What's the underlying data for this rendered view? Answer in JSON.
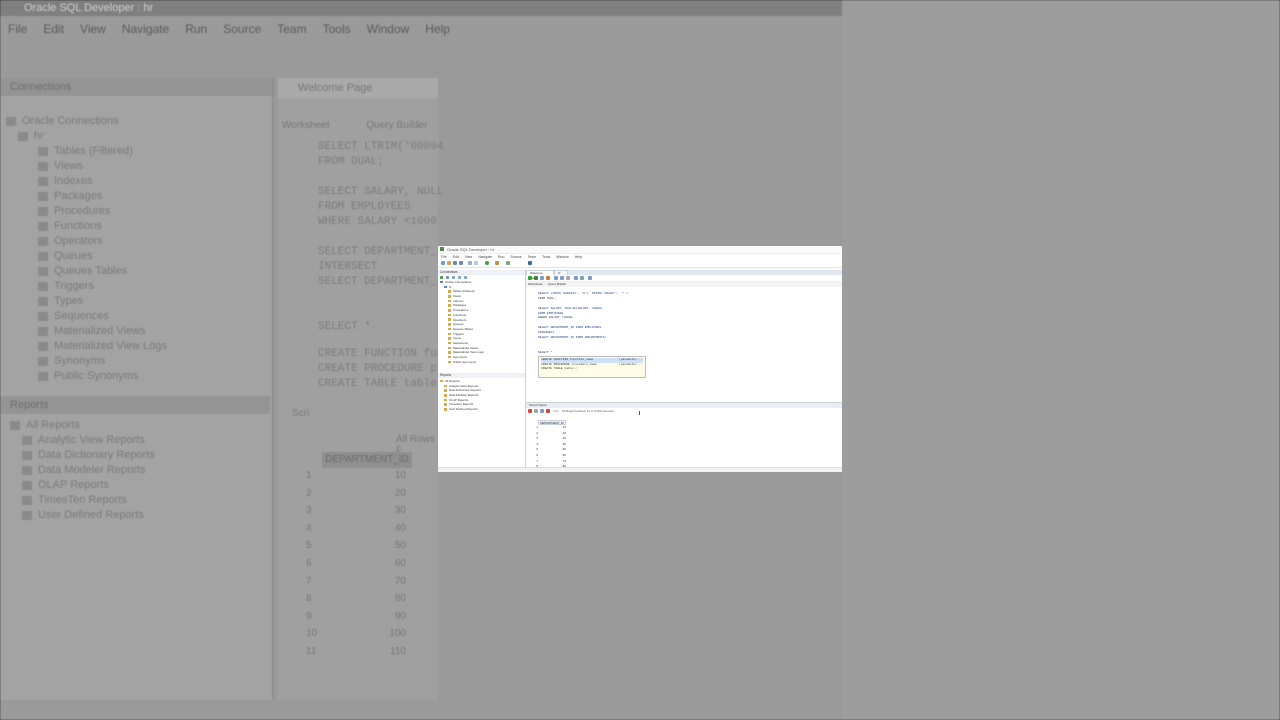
{
  "window_title": "Oracle SQL Developer : hr",
  "menus": [
    "File",
    "Edit",
    "View",
    "Navigate",
    "Run",
    "Source",
    "Team",
    "Tools",
    "Window",
    "Help"
  ],
  "connections_panel": {
    "title": "Connections",
    "root": "Oracle Connections",
    "connection": "hr",
    "items": [
      "Tables (Filtered)",
      "Views",
      "Indexes",
      "Packages",
      "Procedures",
      "Functions",
      "Operators",
      "Queues",
      "Queues Tables",
      "Triggers",
      "Types",
      "Sequences",
      "Materialized Views",
      "Materialized View Logs",
      "Synonyms",
      "Public Synonyms"
    ]
  },
  "reports_panel": {
    "title": "Reports",
    "items": [
      "All Reports",
      "Analytic View Reports",
      "Data Dictionary Reports",
      "Data Modeler Reports",
      "OLAP Reports",
      "TimesTen Reports",
      "User Defined Reports"
    ]
  },
  "editor_tabs": [
    "Welcome Page",
    "hr"
  ],
  "sub_tabs": [
    "Worksheet",
    "Query Builder"
  ],
  "editor_lines": [
    "SELECT LTRIM('0000423', '0'), RTRIM('$5000*', '*')",
    "FROM DUAL;",
    "",
    "SELECT SALARY, NULLIF(SALARY, 10000)",
    "FROM EMPLOYEES",
    "WHERE SALARY <10000;",
    "",
    "SELECT DEPARTMENT_ID FROM EMPLOYEES",
    "INTERSECT",
    "SELECT DEPARTMENT_ID FROM DEPARTMENTS;",
    "",
    "",
    "SELECT *"
  ],
  "autocomplete": [
    {
      "left": "CREATE FUNCTION function_name",
      "right": "(parameter..."
    },
    {
      "left": "CREATE PROCEDURE procedure_name",
      "right": "(parameter..."
    },
    {
      "left": "CREATE TABLE table (",
      "right": ""
    }
  ],
  "results": {
    "tab_label": "Script Output",
    "status": "All Rows Fetched: 11 in 0.006 seconds",
    "column": "DEPARTMENT_ID",
    "rows": [
      {
        "n": "1",
        "v": "10"
      },
      {
        "n": "2",
        "v": "20"
      },
      {
        "n": "3",
        "v": "30"
      },
      {
        "n": "4",
        "v": "40"
      },
      {
        "n": "5",
        "v": "50"
      },
      {
        "n": "6",
        "v": "60"
      },
      {
        "n": "7",
        "v": "70"
      },
      {
        "n": "8",
        "v": "80"
      },
      {
        "n": "9",
        "v": "90"
      },
      {
        "n": "10",
        "v": "100"
      },
      {
        "n": "11",
        "v": "110"
      }
    ]
  },
  "bg_snippets": {
    "code_lines": [
      "SELECT LTRIM('00004",
      "FROM DUAL;",
      "",
      "SELECT SALARY, NULL",
      "FROM EMPLOYEES",
      "WHERE SALARY <1000",
      "",
      "SELECT DEPARTMENT_ID",
      "INTERSECT",
      "SELECT DEPARTMENT_I",
      "",
      "",
      "SELECT *"
    ],
    "popup_lines": [
      "CREATE FUNCTION fun",
      "CREATE PROCEDURE p",
      "CREATE TABLE table"
    ],
    "results_tab": "Scri",
    "results_status": "All Rows F"
  }
}
